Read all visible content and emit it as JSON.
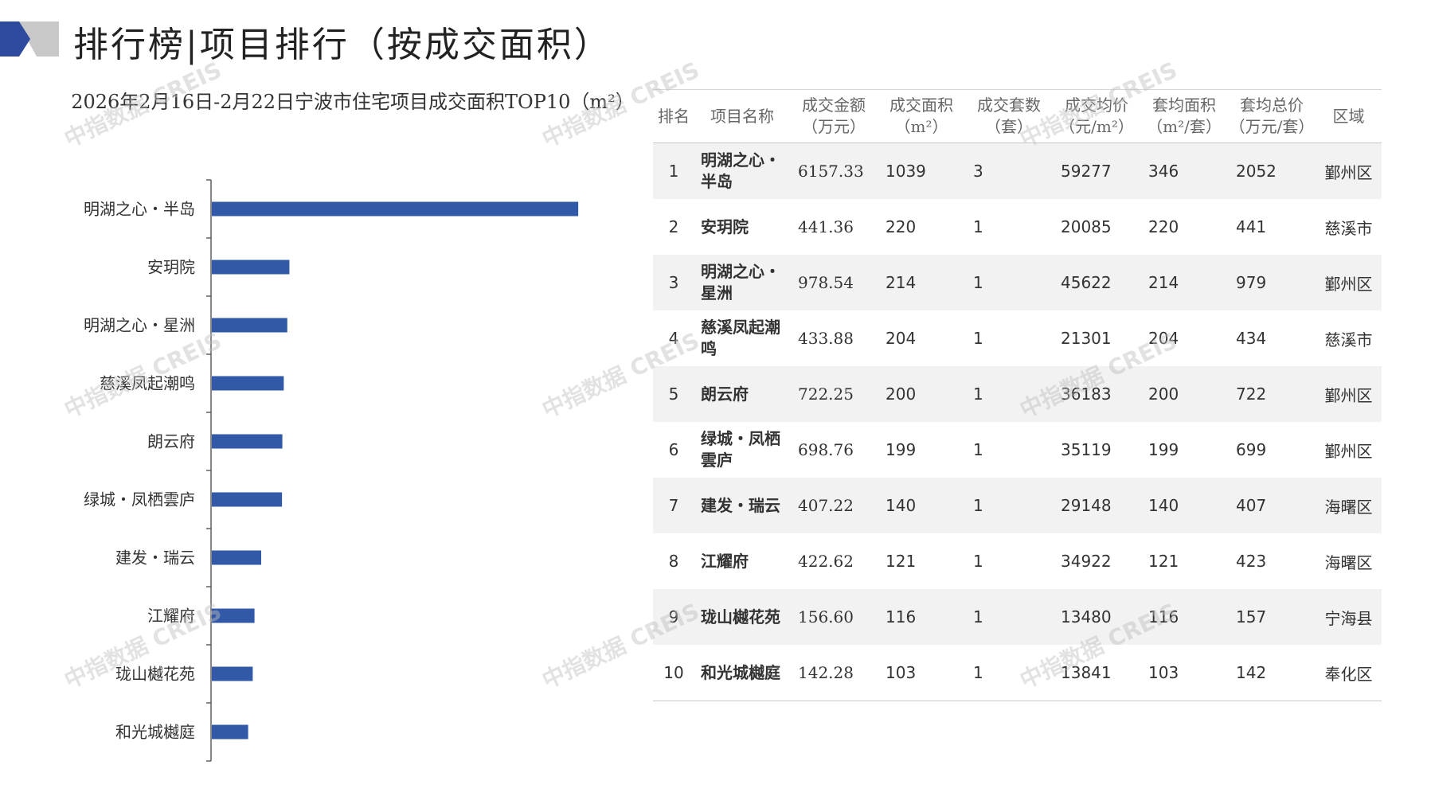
{
  "header": {
    "title": "排行榜|项目排行（按成交面积）"
  },
  "colors": {
    "bar": "#3259a8",
    "logo_dark": "#2e4a9e",
    "logo_gray": "#c8c8c8"
  },
  "watermark": "中指数据 CREIS",
  "chart_data": {
    "type": "bar",
    "orientation": "horizontal",
    "title": "2026年2月16日-2月22日宁波市住宅项目成交面积TOP10（m²）",
    "categories": [
      "明湖之心・半岛",
      "安玥院",
      "明湖之心・星洲",
      "慈溪凤起潮鸣",
      "朗云府",
      "绿城・凤栖雲庐",
      "建发・瑞云",
      "江耀府",
      "珑山樾花苑",
      "和光城樾庭"
    ],
    "values": [
      1039,
      220,
      214,
      204,
      200,
      199,
      140,
      121,
      116,
      103
    ],
    "xlim": [
      0,
      1400
    ],
    "grid": false,
    "legend": "none"
  },
  "table": {
    "headers": [
      "排名",
      "项目名称",
      "成交金额\n（万元）",
      "成交面积\n（m²）",
      "成交套数\n（套）",
      "成交均价\n（元/m²）",
      "套均面积\n（m²/套）",
      "套均总价\n（万元/套）",
      "区域"
    ],
    "rows": [
      [
        "1",
        "明湖之心・半岛",
        "6157.33",
        "1039",
        "3",
        "59277",
        "346",
        "2052",
        "鄞州区"
      ],
      [
        "2",
        "安玥院",
        "441.36",
        "220",
        "1",
        "20085",
        "220",
        "441",
        "慈溪市"
      ],
      [
        "3",
        "明湖之心・星洲",
        "978.54",
        "214",
        "1",
        "45622",
        "214",
        "979",
        "鄞州区"
      ],
      [
        "4",
        "慈溪凤起潮鸣",
        "433.88",
        "204",
        "1",
        "21301",
        "204",
        "434",
        "慈溪市"
      ],
      [
        "5",
        "朗云府",
        "722.25",
        "200",
        "1",
        "36183",
        "200",
        "722",
        "鄞州区"
      ],
      [
        "6",
        "绿城・凤栖雲庐",
        "698.76",
        "199",
        "1",
        "35119",
        "199",
        "699",
        "鄞州区"
      ],
      [
        "7",
        "建发・瑞云",
        "407.22",
        "140",
        "1",
        "29148",
        "140",
        "407",
        "海曙区"
      ],
      [
        "8",
        "江耀府",
        "422.62",
        "121",
        "1",
        "34922",
        "121",
        "423",
        "海曙区"
      ],
      [
        "9",
        "珑山樾花苑",
        "156.60",
        "116",
        "1",
        "13480",
        "116",
        "157",
        "宁海县"
      ],
      [
        "10",
        "和光城樾庭",
        "142.28",
        "103",
        "1",
        "13841",
        "103",
        "142",
        "奉化区"
      ]
    ]
  }
}
